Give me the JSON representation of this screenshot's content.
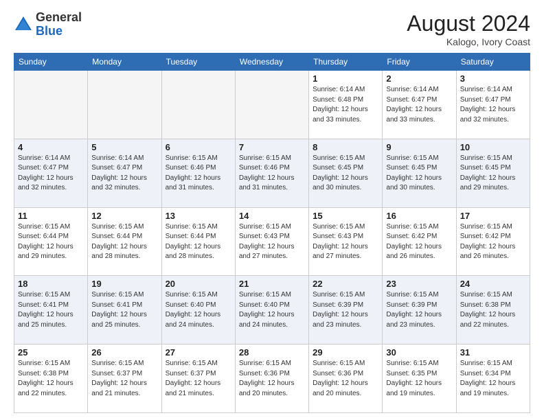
{
  "header": {
    "logo_general": "General",
    "logo_blue": "Blue",
    "month_year": "August 2024",
    "location": "Kalogo, Ivory Coast"
  },
  "days_of_week": [
    "Sunday",
    "Monday",
    "Tuesday",
    "Wednesday",
    "Thursday",
    "Friday",
    "Saturday"
  ],
  "weeks": [
    [
      {
        "day": "",
        "info": ""
      },
      {
        "day": "",
        "info": ""
      },
      {
        "day": "",
        "info": ""
      },
      {
        "day": "",
        "info": ""
      },
      {
        "day": "1",
        "info": "Sunrise: 6:14 AM\nSunset: 6:48 PM\nDaylight: 12 hours\nand 33 minutes."
      },
      {
        "day": "2",
        "info": "Sunrise: 6:14 AM\nSunset: 6:47 PM\nDaylight: 12 hours\nand 33 minutes."
      },
      {
        "day": "3",
        "info": "Sunrise: 6:14 AM\nSunset: 6:47 PM\nDaylight: 12 hours\nand 32 minutes."
      }
    ],
    [
      {
        "day": "4",
        "info": "Sunrise: 6:14 AM\nSunset: 6:47 PM\nDaylight: 12 hours\nand 32 minutes."
      },
      {
        "day": "5",
        "info": "Sunrise: 6:14 AM\nSunset: 6:47 PM\nDaylight: 12 hours\nand 32 minutes."
      },
      {
        "day": "6",
        "info": "Sunrise: 6:15 AM\nSunset: 6:46 PM\nDaylight: 12 hours\nand 31 minutes."
      },
      {
        "day": "7",
        "info": "Sunrise: 6:15 AM\nSunset: 6:46 PM\nDaylight: 12 hours\nand 31 minutes."
      },
      {
        "day": "8",
        "info": "Sunrise: 6:15 AM\nSunset: 6:45 PM\nDaylight: 12 hours\nand 30 minutes."
      },
      {
        "day": "9",
        "info": "Sunrise: 6:15 AM\nSunset: 6:45 PM\nDaylight: 12 hours\nand 30 minutes."
      },
      {
        "day": "10",
        "info": "Sunrise: 6:15 AM\nSunset: 6:45 PM\nDaylight: 12 hours\nand 29 minutes."
      }
    ],
    [
      {
        "day": "11",
        "info": "Sunrise: 6:15 AM\nSunset: 6:44 PM\nDaylight: 12 hours\nand 29 minutes."
      },
      {
        "day": "12",
        "info": "Sunrise: 6:15 AM\nSunset: 6:44 PM\nDaylight: 12 hours\nand 28 minutes."
      },
      {
        "day": "13",
        "info": "Sunrise: 6:15 AM\nSunset: 6:44 PM\nDaylight: 12 hours\nand 28 minutes."
      },
      {
        "day": "14",
        "info": "Sunrise: 6:15 AM\nSunset: 6:43 PM\nDaylight: 12 hours\nand 27 minutes."
      },
      {
        "day": "15",
        "info": "Sunrise: 6:15 AM\nSunset: 6:43 PM\nDaylight: 12 hours\nand 27 minutes."
      },
      {
        "day": "16",
        "info": "Sunrise: 6:15 AM\nSunset: 6:42 PM\nDaylight: 12 hours\nand 26 minutes."
      },
      {
        "day": "17",
        "info": "Sunrise: 6:15 AM\nSunset: 6:42 PM\nDaylight: 12 hours\nand 26 minutes."
      }
    ],
    [
      {
        "day": "18",
        "info": "Sunrise: 6:15 AM\nSunset: 6:41 PM\nDaylight: 12 hours\nand 25 minutes."
      },
      {
        "day": "19",
        "info": "Sunrise: 6:15 AM\nSunset: 6:41 PM\nDaylight: 12 hours\nand 25 minutes."
      },
      {
        "day": "20",
        "info": "Sunrise: 6:15 AM\nSunset: 6:40 PM\nDaylight: 12 hours\nand 24 minutes."
      },
      {
        "day": "21",
        "info": "Sunrise: 6:15 AM\nSunset: 6:40 PM\nDaylight: 12 hours\nand 24 minutes."
      },
      {
        "day": "22",
        "info": "Sunrise: 6:15 AM\nSunset: 6:39 PM\nDaylight: 12 hours\nand 23 minutes."
      },
      {
        "day": "23",
        "info": "Sunrise: 6:15 AM\nSunset: 6:39 PM\nDaylight: 12 hours\nand 23 minutes."
      },
      {
        "day": "24",
        "info": "Sunrise: 6:15 AM\nSunset: 6:38 PM\nDaylight: 12 hours\nand 22 minutes."
      }
    ],
    [
      {
        "day": "25",
        "info": "Sunrise: 6:15 AM\nSunset: 6:38 PM\nDaylight: 12 hours\nand 22 minutes."
      },
      {
        "day": "26",
        "info": "Sunrise: 6:15 AM\nSunset: 6:37 PM\nDaylight: 12 hours\nand 21 minutes."
      },
      {
        "day": "27",
        "info": "Sunrise: 6:15 AM\nSunset: 6:37 PM\nDaylight: 12 hours\nand 21 minutes."
      },
      {
        "day": "28",
        "info": "Sunrise: 6:15 AM\nSunset: 6:36 PM\nDaylight: 12 hours\nand 20 minutes."
      },
      {
        "day": "29",
        "info": "Sunrise: 6:15 AM\nSunset: 6:36 PM\nDaylight: 12 hours\nand 20 minutes."
      },
      {
        "day": "30",
        "info": "Sunrise: 6:15 AM\nSunset: 6:35 PM\nDaylight: 12 hours\nand 19 minutes."
      },
      {
        "day": "31",
        "info": "Sunrise: 6:15 AM\nSunset: 6:34 PM\nDaylight: 12 hours\nand 19 minutes."
      }
    ]
  ]
}
